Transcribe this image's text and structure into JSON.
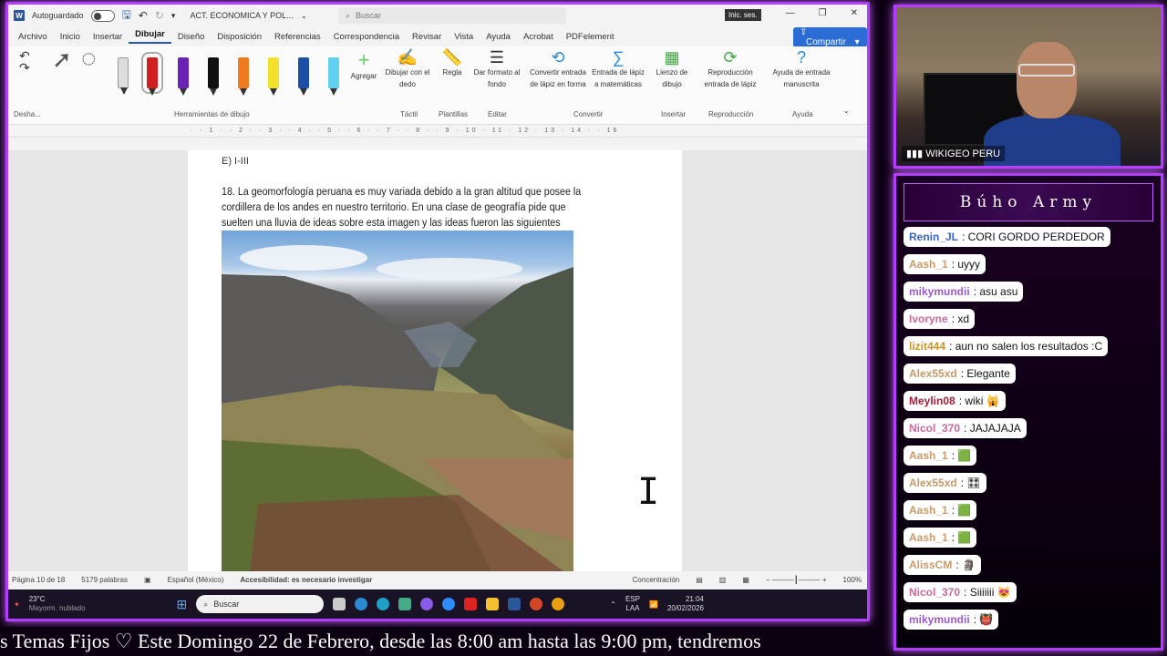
{
  "word": {
    "autosave_label": "Autoguardado",
    "doc_title": "ACT. ECONOMICA Y POL...",
    "search_placeholder": "Buscar",
    "signin": "Inic. ses.",
    "menu": [
      "Archivo",
      "Inicio",
      "Insertar",
      "Dibujar",
      "Diseño",
      "Disposición",
      "Referencias",
      "Correspondencia",
      "Revisar",
      "Vista",
      "Ayuda",
      "Acrobat",
      "PDFelement"
    ],
    "share_label": "Compartir",
    "ribbon": {
      "undo_group": "Desha...",
      "drawing_tools": "Herramientas de dibujo",
      "add": "Agregar",
      "draw_finger": "Dibujar con el dedo",
      "ruler": "Regla",
      "format_bg": "Dar formato al fondo",
      "convert_shape": "Convertir entrada de lápiz en forma",
      "math_input": "Entrada de lápiz a matemáticas",
      "canvas": "Lienzo de dibujo",
      "replay": "Reproducción entrada de lápiz",
      "help_ink": "Ayuda de entrada manuscrita",
      "groups": [
        "Táctil",
        "Plantillas",
        "Editar",
        "Convertir",
        "Insertar",
        "Reproducción",
        "Ayuda"
      ]
    },
    "doc": {
      "top_fragment": "E) I-III",
      "paragraph": "18. La geomorfología peruana es muy variada debido a la gran altitud que posee la cordillera de los andes en nuestro territorio. En una clase de geografía pide que suelten una lluvia de ideas sobre esta imagen y las ideas fueron las siguientes"
    },
    "status": {
      "page": "Página 10 de 18",
      "words": "5179 palabras",
      "lang": "Español (México)",
      "accessibility": "Accesibilidad: es necesario investigar",
      "focus": "Concentración",
      "zoom": "100%"
    },
    "taskbar": {
      "temp": "23°C",
      "weather": "Mayorm. nublado",
      "search": "Buscar",
      "lang": "ESP",
      "lang2": "LAA",
      "time": "21:04",
      "date": "20/02/2026"
    }
  },
  "cam": {
    "label": "WIKIGEO PERU"
  },
  "chat": {
    "title": "Búho Army",
    "messages": [
      {
        "user": "Renin_JL",
        "text": "CORI GORDO PERDEDOR",
        "color": "#3a63c8"
      },
      {
        "user": "Aash_1",
        "text": "uyyy",
        "color": "#c69a6a"
      },
      {
        "user": "mikymundii",
        "text": "asu asu",
        "color": "#9a5ac8"
      },
      {
        "user": "Ivoryne",
        "text": "xd",
        "color": "#c86a9a"
      },
      {
        "user": "lizit444",
        "text": "aun no salen los resultados :C",
        "color": "#c8952a"
      },
      {
        "user": "Alex55xd",
        "text": "Elegante",
        "color": "#c69a6a"
      },
      {
        "user": "Meylin08",
        "text": "wiki 🙀",
        "color": "#a0203a"
      },
      {
        "user": "Nicol_370",
        "text": "JAJAJAJA",
        "color": "#c86a9a"
      },
      {
        "user": "Aash_1",
        "text": "🟩",
        "color": "#c69a6a"
      },
      {
        "user": "Alex55xd",
        "text": "🎛",
        "color": "#c69a6a"
      },
      {
        "user": "Aash_1",
        "text": "🟩",
        "color": "#c69a6a"
      },
      {
        "user": "Aash_1",
        "text": "🟩",
        "color": "#c69a6a"
      },
      {
        "user": "AlissCM",
        "text": "🗿",
        "color": "#c69a6a"
      },
      {
        "user": "Nicol_370",
        "text": "Siiiiiii 😻",
        "color": "#c86a9a"
      },
      {
        "user": "mikymundii",
        "text": "👹",
        "color": "#9a5ac8"
      }
    ]
  },
  "ticker": "s Temas Fijos ♡      Este Domingo 22 de Febrero, desde las 8:00 am hasta las 9:00 pm, tendremos"
}
